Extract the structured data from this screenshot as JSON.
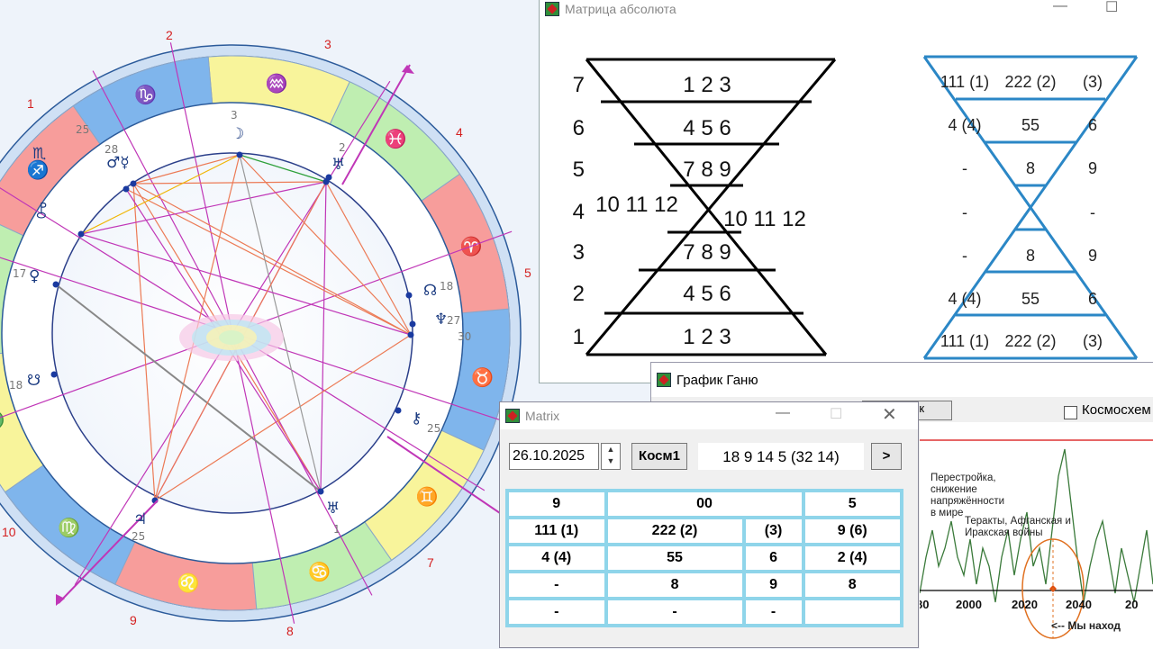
{
  "astro_chart": {
    "house_numbers": [
      "1",
      "2",
      "3",
      "4",
      "5",
      "7",
      "8",
      "9",
      "10"
    ],
    "degree_labels": [
      "25",
      "28",
      "3",
      "2",
      "17",
      "18",
      "18",
      "27",
      "30",
      "25",
      "25",
      "1"
    ]
  },
  "absolute_window": {
    "title": "Матрица абсолюта",
    "left_rows": [
      {
        "row": "7",
        "digits": "1 2 3"
      },
      {
        "row": "6",
        "digits": "4 5 6"
      },
      {
        "row": "5",
        "digits": "7 8 9"
      },
      {
        "row": "4",
        "digits_left": "10 11 12",
        "digits_right": "10 11 12"
      },
      {
        "row": "3",
        "digits": "7 8 9"
      },
      {
        "row": "2",
        "digits": "4 5 6"
      },
      {
        "row": "1",
        "digits": "1 2 3"
      }
    ],
    "right_rows": [
      [
        "111 (1)",
        "222 (2)",
        "(3)"
      ],
      [
        "4 (4)",
        "55",
        "6"
      ],
      [
        "-",
        "8",
        "9"
      ],
      [
        "-",
        "",
        "-"
      ],
      [
        "-",
        "8",
        "9"
      ],
      [
        "4 (4)",
        "55",
        "6"
      ],
      [
        "111 (1)",
        "222 (2)",
        "(3)"
      ]
    ]
  },
  "ganu_window": {
    "title": "График Ганю",
    "button_fragment": "к",
    "checkbox_label": "Космосхем",
    "annotation_1": [
      "Перестройка,",
      "снижение",
      "напряжённости",
      "в мире"
    ],
    "annotation_2": [
      "Теракты, Афганская и",
      "Иракская войны"
    ],
    "x_ticks": [
      "80",
      "2000",
      "2020",
      "2040",
      "20"
    ],
    "footer": "<-- Мы наход"
  },
  "matrix_window": {
    "title": "Matrix",
    "date_value": "26.10.2025",
    "kosm_button": "Косм1",
    "numbers": "18 9 14 5 (32 14)",
    "next_button": ">",
    "rows": [
      [
        "9",
        "00",
        "5"
      ],
      [
        "111 (1)",
        "222 (2)",
        "(3)",
        "9 (6)"
      ],
      [
        "4 (4)",
        "55",
        "6",
        "2 (4)"
      ],
      [
        "-",
        "8",
        "9",
        "8"
      ],
      [
        "-",
        "-",
        "-",
        ""
      ]
    ]
  },
  "colors": {
    "zodiac_red": "#f79d9b",
    "zodiac_green": "#bfeeb1",
    "zodiac_yellow": "#f8f49b",
    "zodiac_blue": "#7fb5ec",
    "outer_ring": "#cfe0f4",
    "aspect_orange": "#ec7a55",
    "aspect_magenta": "#c036b7",
    "matrix_blue": "#2b87c6",
    "table_border": "#8fd5ea"
  }
}
